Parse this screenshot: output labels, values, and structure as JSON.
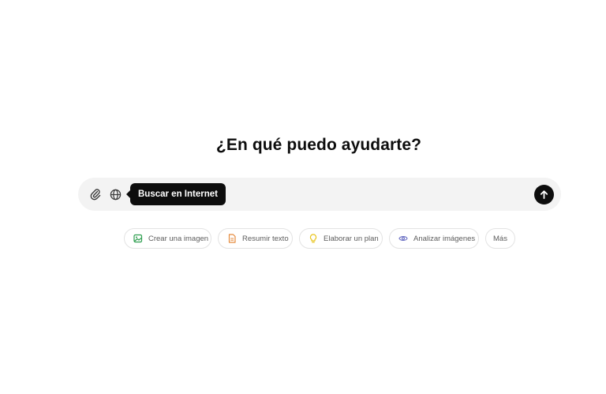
{
  "heading": "¿En qué puedo ayudarte?",
  "composer": {
    "placeholder": "",
    "value": "",
    "tooltip": "Buscar en Internet",
    "icons": {
      "attach": "paperclip-icon",
      "web": "globe-icon",
      "send": "arrow-up-icon"
    }
  },
  "chips": [
    {
      "label": "Crear una imagen",
      "icon": "image-icon",
      "color": "#2e9e4f"
    },
    {
      "label": "Resumir texto",
      "icon": "document-icon",
      "color": "#e58a3c"
    },
    {
      "label": "Elaborar un plan",
      "icon": "lightbulb-icon",
      "color": "#e8c41c"
    },
    {
      "label": "Analizar imágenes",
      "icon": "eye-icon",
      "color": "#6c71c4"
    },
    {
      "label": "Más",
      "icon": "",
      "color": "#5d5d5d"
    }
  ],
  "colors": {
    "background": "#ffffff",
    "composer_bg": "#f3f3f3",
    "accent_dark": "#0d0d0d"
  }
}
